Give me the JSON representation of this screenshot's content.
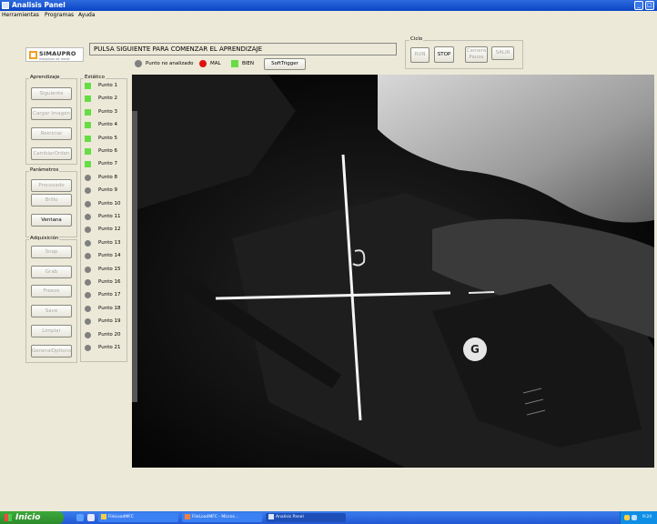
{
  "window": {
    "title": "Analisis Panel"
  },
  "menu": [
    "Herramientas",
    "Programas",
    "Ayuda"
  ],
  "logo": {
    "name": "SIMAUPRO",
    "tagline": "máquinas de medir"
  },
  "message": "PULSA SIGUIENTE PARA COMENZAR EL APRENDIZAJE",
  "legend": {
    "not_analyzed": "Punto no analizado",
    "bad": "MAL",
    "good": "BIEN",
    "soft_trigger": "SoftTrigger"
  },
  "cycle": {
    "label": "Ciclo",
    "run": "RUN",
    "stop": "STOP",
    "camera_pause": "Camera Pause",
    "exit": "SALIR"
  },
  "aprendizaje": {
    "label": "Aprendizaje",
    "siguiente": "Siguiente",
    "cargar_imagen": "Cargar Imagen",
    "reiniciar": "Reiniciar",
    "cambiar_orden": "CambiarOrden"
  },
  "parametros": {
    "label": "Parámetros",
    "procesado": "Procesado",
    "brillo": "Brillo",
    "ventana": "Ventana"
  },
  "adquisicion": {
    "label": "Adquisición",
    "snap": "Snap",
    "grab": "Grab",
    "freeze": "Freeze",
    "save": "Save",
    "limpiar": "Limpiar",
    "general_options": "GeneralOptions"
  },
  "estatico": {
    "label": "Estático",
    "points": [
      "Punto 1",
      "Punto 2",
      "Punto 3",
      "Punto 4",
      "Punto 5",
      "Punto 6",
      "Punto 7",
      "Punto 8",
      "Punto 9",
      "Punto 10",
      "Punto 11",
      "Punto 12",
      "Punto 13",
      "Punto 14",
      "Punto 15",
      "Punto 16",
      "Punto 17",
      "Punto 18",
      "Punto 19",
      "Punto 20",
      "Punto 21"
    ],
    "green_count": 7
  },
  "camera_view": {
    "marker": "G"
  },
  "taskbar": {
    "start": "Inicio",
    "items": [
      "FileLoadMFC",
      "FileLoadMFC - Micros...",
      "Analisis Panel"
    ],
    "clock": "9:24"
  },
  "colors": {
    "good": "#66dd44",
    "bad": "#e01010",
    "not_analyzed": "#808080",
    "title_bar": "#0a45c4"
  }
}
